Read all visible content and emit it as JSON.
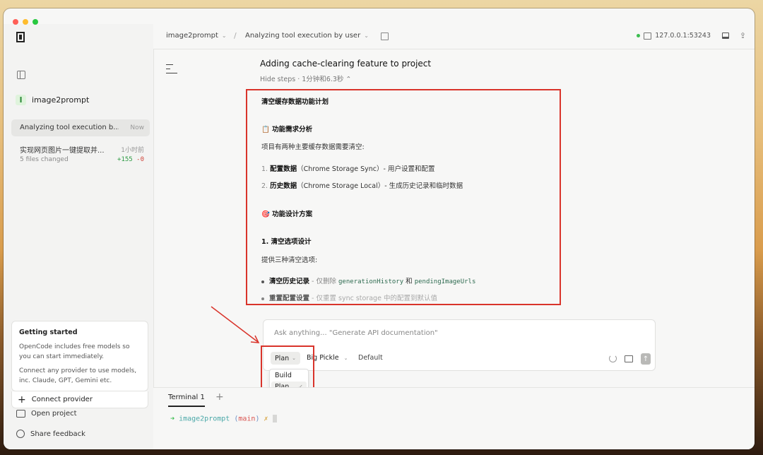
{
  "topbar": {
    "project": "image2prompt",
    "session": "Analyzing tool execution by user",
    "server": "127.0.0.1:53243"
  },
  "sidebar": {
    "project_icon_letter": "I",
    "project_name": "image2prompt",
    "sessions": [
      {
        "title": "Analyzing tool execution b...",
        "time": "Now"
      },
      {
        "title": "实现网页图片一键提取并...",
        "time": "1小时前",
        "files": "5 files changed",
        "added": "+155",
        "removed": "-0"
      }
    ],
    "getting_started": {
      "title": "Getting started",
      "text1": "OpenCode includes free models so you can start immediately.",
      "text2": "Connect any provider to use models, inc. Claude, GPT, Gemini etc."
    },
    "connect_provider": "Connect provider",
    "open_project": "Open project",
    "share_feedback": "Share feedback"
  },
  "main": {
    "task_title": "Adding cache-clearing feature to project",
    "hide_steps": "Hide steps · 1分钟和6.3秒",
    "content": {
      "h1": "清空缓存数据功能计划",
      "h2_emoji": "📋",
      "h2": "功能需求分析",
      "p1": "项目有两种主要缓存数据需要清空:",
      "li1_num": "1.",
      "li1_bold": "配置数据",
      "li1_rest": "（Chrome Storage Sync）- 用户设置和配置",
      "li2_num": "2.",
      "li2_bold": "历史数据",
      "li2_rest": "（Chrome Storage Local）- 生成历史记录和临时数据",
      "h3_emoji": "🎯",
      "h3": "功能设计方案",
      "h4": "1. 清空选项设计",
      "p2": "提供三种清空选项:",
      "b1_bold": "清空历史记录",
      "b1_text": " - 仅删除 ",
      "b1_code1": "generationHistory",
      "b1_and": " 和 ",
      "b1_code2": "pendingImageUrls",
      "b2_bold": "重置配置设置",
      "b2_text": " - 仅重置 sync storage 中的配置到默认值"
    }
  },
  "prompt": {
    "placeholder": "Ask anything... \"Generate API documentation\"",
    "mode": "Plan",
    "model": "Big Pickle",
    "variant": "Default",
    "mode_options": [
      "Build",
      "Plan"
    ]
  },
  "terminal": {
    "tab": "Terminal 1",
    "prompt_dir": "image2prompt",
    "prompt_branch": "main"
  },
  "colors": {
    "highlight": "#d9342b",
    "added": "#2e9b44",
    "removed": "#d0443a",
    "status_dot": "#3bbd4f"
  }
}
